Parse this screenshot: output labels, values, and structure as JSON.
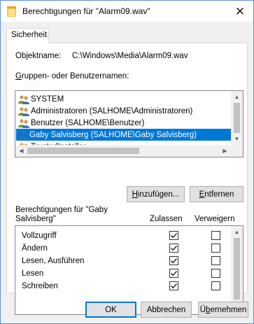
{
  "window": {
    "title": "Berechtigungen für \"Alarm09.wav\"",
    "close_glyph": "✕"
  },
  "tabs": [
    {
      "label": "Sicherheit"
    }
  ],
  "object": {
    "label": "Objektname:",
    "value": "C:\\Windows\\Media\\Alarm09.wav"
  },
  "groups": {
    "label_pre": "",
    "label_u": "G",
    "label_post": "ruppen- oder Benutzernamen:",
    "items": [
      {
        "name": "SYSTEM",
        "icon": "group-users-icon",
        "selected": false
      },
      {
        "name": "Administratoren (SALHOME\\Administratoren)",
        "icon": "group-users-icon",
        "selected": false
      },
      {
        "name": "Benutzer (SALHOME\\Benutzer)",
        "icon": "group-users-icon",
        "selected": false
      },
      {
        "name": "Gaby Salvisberg (SALHOME\\Gaby Salvisberg)",
        "icon": "user-icon",
        "selected": true
      },
      {
        "name": "TrustedInstaller",
        "icon": "group-users-icon",
        "selected": false
      }
    ]
  },
  "buttons": {
    "add_pre": "",
    "add_u": "H",
    "add_post": "inzufügen...",
    "remove_pre": "",
    "remove_u": "E",
    "remove_post": "ntfernen",
    "ok": "OK",
    "cancel": "Abbrechen",
    "apply_pre": "Ü",
    "apply_u": "b",
    "apply_post": "ernehmen"
  },
  "permissions": {
    "header_line1": "Berechtigungen für \"Gaby",
    "header_line2": "Salvisberg\"",
    "allow_label": "Zulassen",
    "deny_label": "Verweigern",
    "rows": [
      {
        "name": "Vollzugriff",
        "allow": true,
        "deny": false
      },
      {
        "name": "Ändern",
        "allow": true,
        "deny": false
      },
      {
        "name": "Lesen, Ausführen",
        "allow": true,
        "deny": false
      },
      {
        "name": "Lesen",
        "allow": true,
        "deny": false
      },
      {
        "name": "Schreiben",
        "allow": true,
        "deny": false
      }
    ]
  },
  "colors": {
    "accent": "#0078d7",
    "frame": "#5c8ee0",
    "folder": "#f7c948"
  }
}
